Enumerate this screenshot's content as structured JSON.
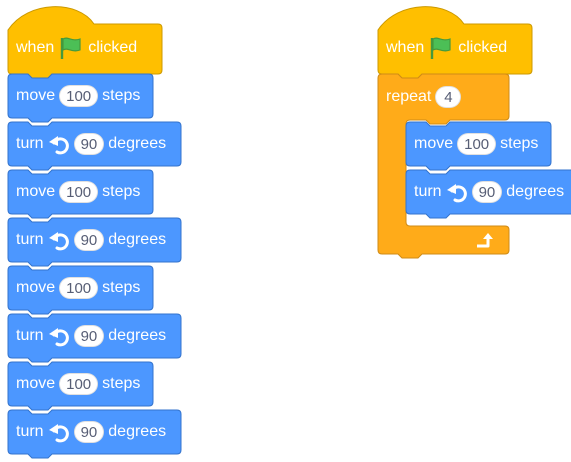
{
  "colors": {
    "events": "#ffbf00",
    "events_border": "#cc9900",
    "control": "#ffab19",
    "control_border": "#cf8b17",
    "motion": "#4c97ff",
    "motion_border": "#3373cc",
    "flag": "#45993d"
  },
  "left_script": {
    "hat": {
      "label_when": "when",
      "flag_icon": "green-flag-icon",
      "label_clicked": "clicked"
    },
    "blocks": [
      {
        "kind": "move",
        "label": "move",
        "value": "100",
        "suffix": "steps"
      },
      {
        "kind": "turn",
        "label": "turn",
        "icon": "rotate-left-icon",
        "value": "90",
        "suffix": "degrees"
      },
      {
        "kind": "move",
        "label": "move",
        "value": "100",
        "suffix": "steps"
      },
      {
        "kind": "turn",
        "label": "turn",
        "icon": "rotate-left-icon",
        "value": "90",
        "suffix": "degrees"
      },
      {
        "kind": "move",
        "label": "move",
        "value": "100",
        "suffix": "steps"
      },
      {
        "kind": "turn",
        "label": "turn",
        "icon": "rotate-left-icon",
        "value": "90",
        "suffix": "degrees"
      },
      {
        "kind": "move",
        "label": "move",
        "value": "100",
        "suffix": "steps"
      },
      {
        "kind": "turn",
        "label": "turn",
        "icon": "rotate-left-icon",
        "value": "90",
        "suffix": "degrees"
      }
    ]
  },
  "right_script": {
    "hat": {
      "label_when": "when",
      "flag_icon": "green-flag-icon",
      "label_clicked": "clicked"
    },
    "repeat": {
      "label": "repeat",
      "value": "4",
      "loop_icon": "loop-arrow-icon",
      "inner": [
        {
          "kind": "move",
          "label": "move",
          "value": "100",
          "suffix": "steps"
        },
        {
          "kind": "turn",
          "label": "turn",
          "icon": "rotate-left-icon",
          "value": "90",
          "suffix": "degrees"
        }
      ]
    }
  }
}
